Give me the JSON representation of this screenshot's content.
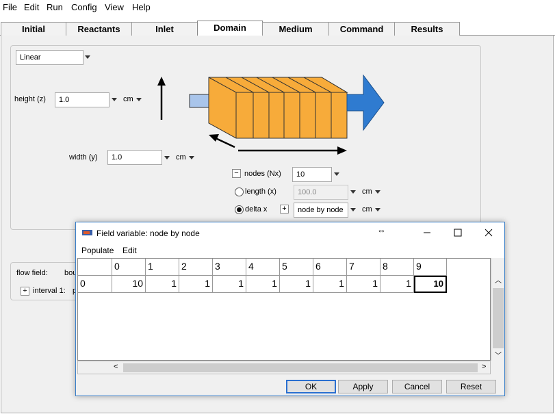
{
  "menu": [
    "File",
    "Edit",
    "Run",
    "Config",
    "View",
    "Help"
  ],
  "tabs": [
    {
      "label": "Initial"
    },
    {
      "label": "Reactants"
    },
    {
      "label": "Inlet"
    },
    {
      "label": "Domain"
    },
    {
      "label": "Medium"
    },
    {
      "label": "Command"
    },
    {
      "label": "Results"
    }
  ],
  "active_tab": "Domain",
  "domain": {
    "geometry_type": "Linear",
    "height_label": "height (z)",
    "height_value": "1.0",
    "height_unit": "cm",
    "width_label": "width (y)",
    "width_value": "1.0",
    "width_unit": "cm",
    "nodes_label": "nodes (Nx)",
    "nodes_value": "10",
    "nodes_toggle": "−",
    "length_label": "length (x)",
    "length_value": "100.0",
    "length_unit": "cm",
    "deltax_label": "delta x",
    "deltax_toggle": "+",
    "deltax_mode": "node by node",
    "deltax_unit": "cm",
    "length_selected": false,
    "deltax_selected": true
  },
  "flow": {
    "label": "flow field:",
    "value_partial": "bou",
    "interval_toggle": "+",
    "interval_label": "interval 1:",
    "interval_partial": "p"
  },
  "colors": {
    "reactor_fill": "#f7ab3a",
    "inlet_fill": "#a9c5eb",
    "outlet_arrow": "#2f7bd0",
    "accent": "#2a6fd0"
  },
  "dialog": {
    "title": "Field variable: node by node",
    "menu": [
      "Populate",
      "Edit"
    ],
    "column_headers": [
      "0",
      "1",
      "2",
      "3",
      "4",
      "5",
      "6",
      "7",
      "8",
      "9"
    ],
    "row_header": "0",
    "row_values": [
      "10",
      "1",
      "1",
      "1",
      "1",
      "1",
      "1",
      "1",
      "1",
      "10"
    ],
    "buttons": {
      "ok": "OK",
      "apply": "Apply",
      "cancel": "Cancel",
      "reset": "Reset"
    }
  }
}
